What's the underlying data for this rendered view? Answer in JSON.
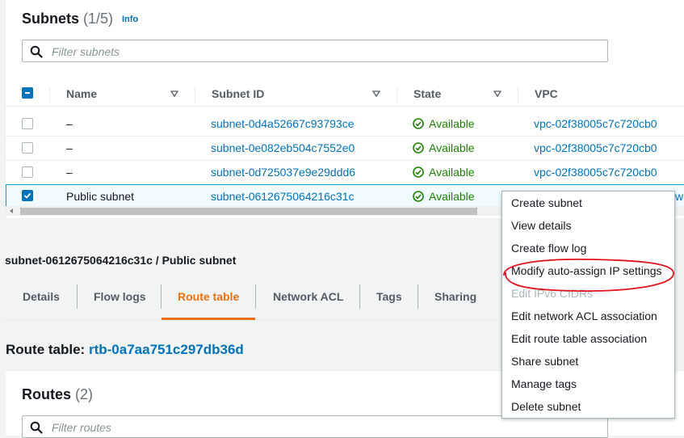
{
  "subnets_panel": {
    "title": "Subnets",
    "count": "(1/5)",
    "info_link": "Info",
    "search_placeholder": "Filter subnets",
    "columns": [
      "Name",
      "Subnet ID",
      "State",
      "VPC"
    ],
    "rows": [
      {
        "name": "–",
        "subnet_id": "subnet-0d4a52667c93793ce",
        "state": "Available",
        "vpc": "vpc-02f38005c7c720cb0",
        "checked": false
      },
      {
        "name": "–",
        "subnet_id": "subnet-0e082eb504c7552e0",
        "state": "Available",
        "vpc": "vpc-02f38005c7c720cb0",
        "checked": false
      },
      {
        "name": "–",
        "subnet_id": "subnet-0d725037e9e29ddd6",
        "state": "Available",
        "vpc": "vpc-02f38005c7c720cb0",
        "checked": false
      },
      {
        "name": "Public subnet",
        "subnet_id": "subnet-0612675064216c31c",
        "state": "Available",
        "vpc": "w",
        "checked": true
      }
    ]
  },
  "detail": {
    "title": "subnet-0612675064216c31c / Public subnet",
    "tabs": [
      "Details",
      "Flow logs",
      "Route table",
      "Network ACL",
      "Tags",
      "Sharing"
    ],
    "active_tab": "Route table",
    "route_table_label": "Route table:",
    "route_table_id": "rtb-0a7aa751c297db36d",
    "routes_title": "Routes",
    "routes_count": "(2)",
    "routes_search_placeholder": "Filter routes"
  },
  "actions_menu": {
    "items": [
      "Create subnet",
      "View details",
      "Create flow log",
      "Modify auto-assign IP settings",
      "Edit IPv6 CIDRs",
      "Edit network ACL association",
      "Edit route table association",
      "Share subnet",
      "Manage tags",
      "Delete subnet"
    ],
    "disabled_item": "Edit IPv6 CIDRs",
    "highlighted_item": "Modify auto-assign IP settings"
  },
  "colors": {
    "link": "#0073bb",
    "available": "#1d8102",
    "active_tab": "#ec7211",
    "annotation": "#e0141e"
  },
  "icons": [
    "search-icon",
    "check-circle-icon",
    "sort-caret-icon",
    "checkbox-icon"
  ]
}
